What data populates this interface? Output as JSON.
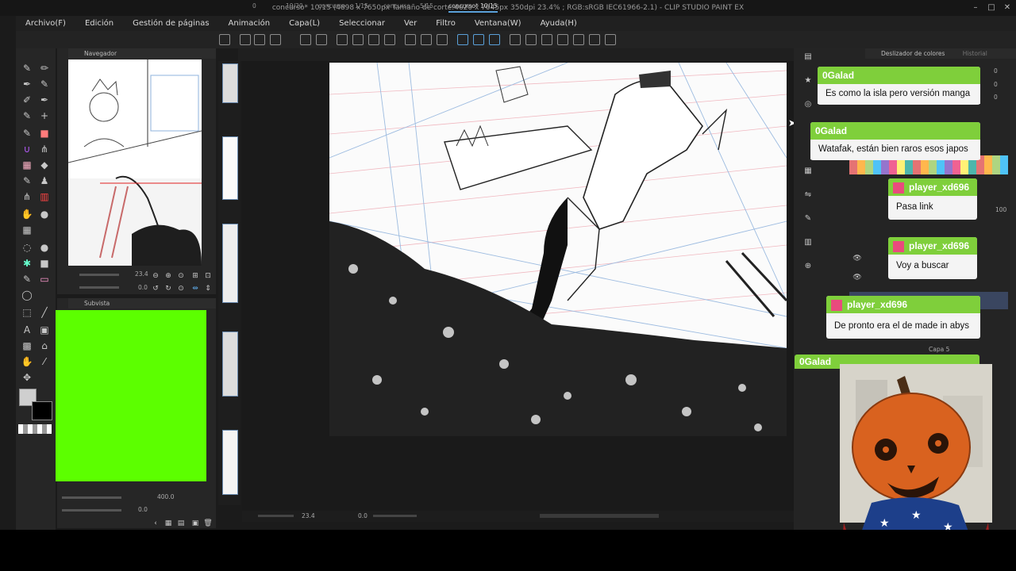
{
  "window": {
    "title": "concurso* 10/15 (4898 x 7650px Tamaño de corte:4620 x 7045px 350dpi 23.4% ; RGB:sRGB IEC61966-2.1) - CLIP STUDIO PAINT EX"
  },
  "menu": [
    "Archivo(F)",
    "Edición",
    "Gestión de páginas",
    "Animación",
    "Capa(L)",
    "Seleccionar",
    "Ver",
    "Filtro",
    "Ventana(W)",
    "Ayuda(H)"
  ],
  "tabs": [
    {
      "label": "0",
      "active": false
    },
    {
      "label": "19/20",
      "active": false
    },
    {
      "label": "concurso",
      "active": false
    },
    {
      "label": "1/15",
      "active": false
    },
    {
      "label": "concurso",
      "active": false
    },
    {
      "label": "5/15",
      "active": false
    },
    {
      "label": "concurso* 10/15",
      "active": true
    }
  ],
  "panels": {
    "navigator": "Navegador",
    "subview": "Subvista",
    "color_slider": "Deslizador de colores",
    "history": "Historial",
    "nav_zoom": "23.4",
    "nav_rotate": "0.0",
    "sub_zoom": "400.0",
    "sub_rotate": "0.0",
    "layer_label": "Capa 5",
    "color_values": [
      "0",
      "0",
      "0"
    ],
    "opacity": "100"
  },
  "status": {
    "zoom": "23.4",
    "rotate": "0.0"
  },
  "chat": [
    {
      "user": "0Galad",
      "text": "Es como la isla pero versión manga"
    },
    {
      "user": "0Galad",
      "text": "Watafak, están bien raros esos japos"
    },
    {
      "user": "player_xd696",
      "text": "Pasa link"
    },
    {
      "user": "player_xd696",
      "text": "Voy a buscar"
    },
    {
      "user": "player_xd696",
      "text": "De pronto era el de made in abys"
    },
    {
      "user": "0Galad",
      "text": ""
    }
  ],
  "colors": {
    "chat_header": "#7fcf3b",
    "accent": "#5aa0d8",
    "subview_green": "#5cff00"
  }
}
